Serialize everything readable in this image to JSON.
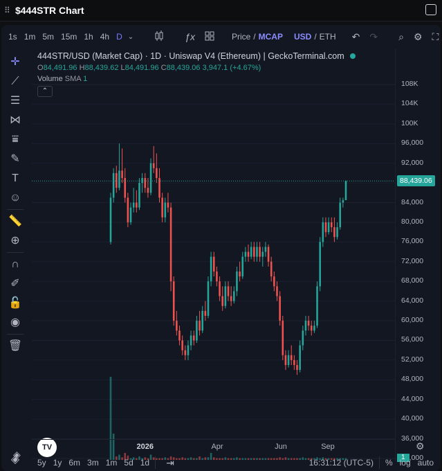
{
  "window": {
    "title": "$444STR Chart"
  },
  "toolbar": {
    "timeframes": [
      "1s",
      "1m",
      "5m",
      "15m",
      "1h",
      "4h",
      "D"
    ],
    "active_timeframe": "D",
    "price_label": "Price",
    "slash1": "/",
    "mcap_label": "MCAP",
    "usd_label": "USD",
    "slash2": "/",
    "eth_label": "ETH"
  },
  "legend": {
    "title": "444STR/USD (Market Cap) · 1D · Uniswap V4 (Ethereum) | GeckoTerminal.com",
    "o_label": "O",
    "o_value": "84,491.96",
    "h_label": "H",
    "h_value": "88,439.62",
    "l_label": "L",
    "l_value": "84,491.96",
    "c_label": "C",
    "c_value": "88,439.06",
    "change": "3,947.1 (+4.67%)",
    "volume_label": "Volume",
    "volume_indicator": "SMA",
    "volume_value": "1"
  },
  "price_axis": {
    "ticks": [
      "108K",
      "104K",
      "100K",
      "96,000",
      "92,000",
      "88,000",
      "84,000",
      "80,000",
      "76,000",
      "72,000",
      "68,000",
      "64,000",
      "60,000",
      "56,000",
      "52,000",
      "48,000",
      "44,000",
      "40,000",
      "36,000",
      "32,000"
    ],
    "last_price": "88,439.06",
    "volume_badge": "1"
  },
  "time_axis": {
    "labels": [
      "2026",
      "Apr",
      "Jun",
      "Sep"
    ]
  },
  "bottom": {
    "ranges": [
      "5y",
      "1y",
      "6m",
      "3m",
      "1m",
      "5d",
      "1d"
    ],
    "clock": "16:31:12 (UTC-5)",
    "percent": "%",
    "log": "log",
    "auto": "auto"
  },
  "colors": {
    "up": "#26a69a",
    "down": "#ef5350",
    "background": "#131722",
    "accent": "#787bff"
  },
  "chart_data": {
    "type": "candlestick",
    "y_unit": "USD market cap",
    "ylim": [
      32000,
      108000
    ],
    "x_labels": [
      "2026",
      "Apr",
      "Jun",
      "Sep"
    ],
    "candles": [
      {
        "date": "2025-12-20",
        "o": 76000,
        "h": 86000,
        "l": 75500,
        "c": 85000
      },
      {
        "date": "2025-12-21",
        "o": 85000,
        "h": 91000,
        "l": 84000,
        "c": 90000
      },
      {
        "date": "2025-12-22",
        "o": 90000,
        "h": 91500,
        "l": 86000,
        "c": 87000
      },
      {
        "date": "2025-12-23",
        "o": 87000,
        "h": 96000,
        "l": 86500,
        "c": 90500
      },
      {
        "date": "2025-12-24",
        "o": 90500,
        "h": 95000,
        "l": 88000,
        "c": 89000
      },
      {
        "date": "2025-12-25",
        "o": 89000,
        "h": 91000,
        "l": 84000,
        "c": 85000
      },
      {
        "date": "2025-12-26",
        "o": 85000,
        "h": 86000,
        "l": 79000,
        "c": 80000
      },
      {
        "date": "2025-12-27",
        "o": 80000,
        "h": 84000,
        "l": 79500,
        "c": 83000
      },
      {
        "date": "2025-12-28",
        "o": 83000,
        "h": 87000,
        "l": 82000,
        "c": 84000
      },
      {
        "date": "2025-12-29",
        "o": 84000,
        "h": 86500,
        "l": 82000,
        "c": 83000
      },
      {
        "date": "2025-12-30",
        "o": 83000,
        "h": 89000,
        "l": 82500,
        "c": 88000
      },
      {
        "date": "2025-12-31",
        "o": 88000,
        "h": 90000,
        "l": 86000,
        "c": 89000
      },
      {
        "date": "2026-01-01",
        "o": 89000,
        "h": 90000,
        "l": 86000,
        "c": 87000
      },
      {
        "date": "2026-01-02",
        "o": 87000,
        "h": 89000,
        "l": 85000,
        "c": 86000
      },
      {
        "date": "2026-01-03",
        "o": 86000,
        "h": 93000,
        "l": 85500,
        "c": 92000
      },
      {
        "date": "2026-01-04",
        "o": 92000,
        "h": 95500,
        "l": 90000,
        "c": 91000
      },
      {
        "date": "2026-01-05",
        "o": 91000,
        "h": 94000,
        "l": 88000,
        "c": 89000
      },
      {
        "date": "2026-01-06",
        "o": 89000,
        "h": 91000,
        "l": 84000,
        "c": 85000
      },
      {
        "date": "2026-01-07",
        "o": 85000,
        "h": 86000,
        "l": 80000,
        "c": 81000
      },
      {
        "date": "2026-01-08",
        "o": 81000,
        "h": 85000,
        "l": 80000,
        "c": 84000
      },
      {
        "date": "2026-01-09",
        "o": 84000,
        "h": 86000,
        "l": 82000,
        "c": 83000
      },
      {
        "date": "2026-01-10",
        "o": 83000,
        "h": 84000,
        "l": 66000,
        "c": 68000
      },
      {
        "date": "2026-01-11",
        "o": 68000,
        "h": 69000,
        "l": 59000,
        "c": 60000
      },
      {
        "date": "2026-01-12",
        "o": 60000,
        "h": 62000,
        "l": 57000,
        "c": 58000
      },
      {
        "date": "2026-01-13",
        "o": 58000,
        "h": 59000,
        "l": 55000,
        "c": 56000
      },
      {
        "date": "2026-01-14",
        "o": 56000,
        "h": 57000,
        "l": 53000,
        "c": 54000
      },
      {
        "date": "2026-01-15",
        "o": 54000,
        "h": 55000,
        "l": 52000,
        "c": 53000
      },
      {
        "date": "2026-01-16",
        "o": 53000,
        "h": 56000,
        "l": 52000,
        "c": 55000
      },
      {
        "date": "2026-01-17",
        "o": 55000,
        "h": 58000,
        "l": 54000,
        "c": 57000
      },
      {
        "date": "2026-01-18",
        "o": 57000,
        "h": 58000,
        "l": 55000,
        "c": 56000
      },
      {
        "date": "2026-01-19",
        "o": 56000,
        "h": 61000,
        "l": 55500,
        "c": 60000
      },
      {
        "date": "2026-01-20",
        "o": 60000,
        "h": 62000,
        "l": 57000,
        "c": 58000
      },
      {
        "date": "2026-01-21",
        "o": 58000,
        "h": 63000,
        "l": 57500,
        "c": 62000
      },
      {
        "date": "2026-01-22",
        "o": 62000,
        "h": 64000,
        "l": 60000,
        "c": 61000
      },
      {
        "date": "2026-01-23",
        "o": 61000,
        "h": 69000,
        "l": 60500,
        "c": 68000
      },
      {
        "date": "2026-01-24",
        "o": 68000,
        "h": 74000,
        "l": 67000,
        "c": 73000
      },
      {
        "date": "2026-01-25",
        "o": 73000,
        "h": 74000,
        "l": 69000,
        "c": 70000
      },
      {
        "date": "2026-01-26",
        "o": 70000,
        "h": 71000,
        "l": 67000,
        "c": 68000
      },
      {
        "date": "2026-01-27",
        "o": 68000,
        "h": 69000,
        "l": 64000,
        "c": 65000
      },
      {
        "date": "2026-01-28",
        "o": 65000,
        "h": 67000,
        "l": 62000,
        "c": 63000
      },
      {
        "date": "2026-01-29",
        "o": 63000,
        "h": 68000,
        "l": 62500,
        "c": 67000
      },
      {
        "date": "2026-01-30",
        "o": 67000,
        "h": 68000,
        "l": 64000,
        "c": 65000
      },
      {
        "date": "2026-01-31",
        "o": 65000,
        "h": 67000,
        "l": 63000,
        "c": 64000
      },
      {
        "date": "2026-02-01",
        "o": 64000,
        "h": 67000,
        "l": 63500,
        "c": 66000
      },
      {
        "date": "2026-02-02",
        "o": 66000,
        "h": 71000,
        "l": 65000,
        "c": 70000
      },
      {
        "date": "2026-02-03",
        "o": 70000,
        "h": 72000,
        "l": 68000,
        "c": 69000
      },
      {
        "date": "2026-02-04",
        "o": 69000,
        "h": 74000,
        "l": 68500,
        "c": 73000
      },
      {
        "date": "2026-02-05",
        "o": 73000,
        "h": 75000,
        "l": 72000,
        "c": 74000
      },
      {
        "date": "2026-02-06",
        "o": 74000,
        "h": 75500,
        "l": 72000,
        "c": 73000
      },
      {
        "date": "2026-02-07",
        "o": 73000,
        "h": 76000,
        "l": 72500,
        "c": 75000
      },
      {
        "date": "2026-02-08",
        "o": 75000,
        "h": 76000,
        "l": 72000,
        "c": 73000
      },
      {
        "date": "2026-02-09",
        "o": 73000,
        "h": 76000,
        "l": 72000,
        "c": 75000
      },
      {
        "date": "2026-02-10",
        "o": 75000,
        "h": 76000,
        "l": 72000,
        "c": 73000
      },
      {
        "date": "2026-02-11",
        "o": 73000,
        "h": 75000,
        "l": 71000,
        "c": 74000
      },
      {
        "date": "2026-02-12",
        "o": 74000,
        "h": 76000,
        "l": 73000,
        "c": 75000
      },
      {
        "date": "2026-02-13",
        "o": 75000,
        "h": 75500,
        "l": 71000,
        "c": 72000
      },
      {
        "date": "2026-02-14",
        "o": 72000,
        "h": 73000,
        "l": 68000,
        "c": 69000
      },
      {
        "date": "2026-02-15",
        "o": 69000,
        "h": 70000,
        "l": 66000,
        "c": 67000
      },
      {
        "date": "2026-02-16",
        "o": 67000,
        "h": 68000,
        "l": 64000,
        "c": 65000
      },
      {
        "date": "2026-02-17",
        "o": 65000,
        "h": 66000,
        "l": 59000,
        "c": 60000
      },
      {
        "date": "2026-02-18",
        "o": 60000,
        "h": 61000,
        "l": 52000,
        "c": 53000
      },
      {
        "date": "2026-02-19",
        "o": 53000,
        "h": 54000,
        "l": 50000,
        "c": 51000
      },
      {
        "date": "2026-02-20",
        "o": 51000,
        "h": 54000,
        "l": 50500,
        "c": 53000
      },
      {
        "date": "2026-02-21",
        "o": 53000,
        "h": 55000,
        "l": 51000,
        "c": 52000
      },
      {
        "date": "2026-02-22",
        "o": 52000,
        "h": 53000,
        "l": 50000,
        "c": 51000
      },
      {
        "date": "2026-02-23",
        "o": 51000,
        "h": 52000,
        "l": 49000,
        "c": 50000
      },
      {
        "date": "2026-02-24",
        "o": 50000,
        "h": 56000,
        "l": 49500,
        "c": 55000
      },
      {
        "date": "2026-02-25",
        "o": 55000,
        "h": 59000,
        "l": 54000,
        "c": 58000
      },
      {
        "date": "2026-02-26",
        "o": 58000,
        "h": 61000,
        "l": 57000,
        "c": 60000
      },
      {
        "date": "2026-02-27",
        "o": 60000,
        "h": 61000,
        "l": 58000,
        "c": 59000
      },
      {
        "date": "2026-02-28",
        "o": 59000,
        "h": 60000,
        "l": 57000,
        "c": 58000
      },
      {
        "date": "2026-03-01",
        "o": 58000,
        "h": 60000,
        "l": 57500,
        "c": 59000
      },
      {
        "date": "2026-03-02",
        "o": 59000,
        "h": 68000,
        "l": 58500,
        "c": 67000
      },
      {
        "date": "2026-03-03",
        "o": 67000,
        "h": 77000,
        "l": 66000,
        "c": 76000
      },
      {
        "date": "2026-03-04",
        "o": 76000,
        "h": 81000,
        "l": 75000,
        "c": 80000
      },
      {
        "date": "2026-03-05",
        "o": 80000,
        "h": 81000,
        "l": 77000,
        "c": 78000
      },
      {
        "date": "2026-03-06",
        "o": 78000,
        "h": 81000,
        "l": 77500,
        "c": 80000
      },
      {
        "date": "2026-03-07",
        "o": 80000,
        "h": 81000,
        "l": 78000,
        "c": 79000
      },
      {
        "date": "2026-03-08",
        "o": 79000,
        "h": 81000,
        "l": 76000,
        "c": 77000
      },
      {
        "date": "2026-03-09",
        "o": 77000,
        "h": 80000,
        "l": 76500,
        "c": 79000
      },
      {
        "date": "2026-03-10",
        "o": 79000,
        "h": 85000,
        "l": 78500,
        "c": 84000
      },
      {
        "date": "2026-03-11",
        "o": 84000,
        "h": 85000,
        "l": 83000,
        "c": 84500
      },
      {
        "date": "2026-03-12",
        "o": 84500,
        "h": 88500,
        "l": 84500,
        "c": 88400
      }
    ],
    "volume": [
      95,
      30,
      4,
      6,
      3,
      8,
      5,
      2,
      3,
      2,
      4,
      2,
      3,
      2,
      6,
      3,
      2,
      2,
      2,
      3,
      2,
      4,
      3,
      2,
      2,
      3,
      2,
      2,
      3,
      2,
      2,
      4,
      2,
      3,
      3,
      8,
      3,
      2,
      2,
      2,
      3,
      2,
      2,
      2,
      3,
      2,
      2,
      2,
      2,
      2,
      2,
      2,
      2,
      2,
      2,
      2,
      2,
      2,
      2,
      3,
      2,
      3,
      2,
      2,
      2,
      2,
      2,
      3,
      2,
      2,
      2,
      2,
      3,
      2,
      3,
      2,
      2,
      2,
      2,
      2,
      2,
      2,
      2
    ]
  }
}
